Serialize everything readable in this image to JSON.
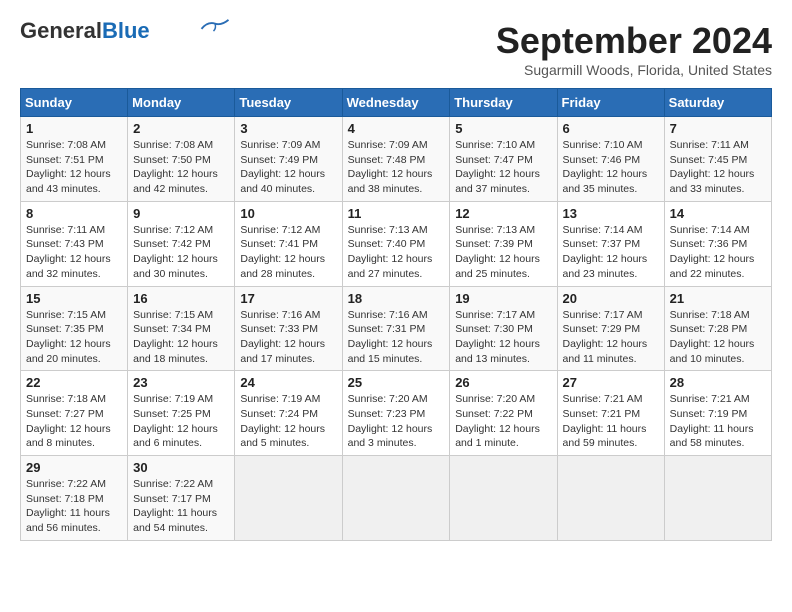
{
  "header": {
    "logo_line1": "General",
    "logo_line2": "Blue",
    "title": "September 2024",
    "subtitle": "Sugarmill Woods, Florida, United States"
  },
  "days_of_week": [
    "Sunday",
    "Monday",
    "Tuesday",
    "Wednesday",
    "Thursday",
    "Friday",
    "Saturday"
  ],
  "weeks": [
    [
      {
        "day": "1",
        "sunrise": "7:08 AM",
        "sunset": "7:51 PM",
        "daylight": "12 hours and 43 minutes."
      },
      {
        "day": "2",
        "sunrise": "7:08 AM",
        "sunset": "7:50 PM",
        "daylight": "12 hours and 42 minutes."
      },
      {
        "day": "3",
        "sunrise": "7:09 AM",
        "sunset": "7:49 PM",
        "daylight": "12 hours and 40 minutes."
      },
      {
        "day": "4",
        "sunrise": "7:09 AM",
        "sunset": "7:48 PM",
        "daylight": "12 hours and 38 minutes."
      },
      {
        "day": "5",
        "sunrise": "7:10 AM",
        "sunset": "7:47 PM",
        "daylight": "12 hours and 37 minutes."
      },
      {
        "day": "6",
        "sunrise": "7:10 AM",
        "sunset": "7:46 PM",
        "daylight": "12 hours and 35 minutes."
      },
      {
        "day": "7",
        "sunrise": "7:11 AM",
        "sunset": "7:45 PM",
        "daylight": "12 hours and 33 minutes."
      }
    ],
    [
      {
        "day": "8",
        "sunrise": "7:11 AM",
        "sunset": "7:43 PM",
        "daylight": "12 hours and 32 minutes."
      },
      {
        "day": "9",
        "sunrise": "7:12 AM",
        "sunset": "7:42 PM",
        "daylight": "12 hours and 30 minutes."
      },
      {
        "day": "10",
        "sunrise": "7:12 AM",
        "sunset": "7:41 PM",
        "daylight": "12 hours and 28 minutes."
      },
      {
        "day": "11",
        "sunrise": "7:13 AM",
        "sunset": "7:40 PM",
        "daylight": "12 hours and 27 minutes."
      },
      {
        "day": "12",
        "sunrise": "7:13 AM",
        "sunset": "7:39 PM",
        "daylight": "12 hours and 25 minutes."
      },
      {
        "day": "13",
        "sunrise": "7:14 AM",
        "sunset": "7:37 PM",
        "daylight": "12 hours and 23 minutes."
      },
      {
        "day": "14",
        "sunrise": "7:14 AM",
        "sunset": "7:36 PM",
        "daylight": "12 hours and 22 minutes."
      }
    ],
    [
      {
        "day": "15",
        "sunrise": "7:15 AM",
        "sunset": "7:35 PM",
        "daylight": "12 hours and 20 minutes."
      },
      {
        "day": "16",
        "sunrise": "7:15 AM",
        "sunset": "7:34 PM",
        "daylight": "12 hours and 18 minutes."
      },
      {
        "day": "17",
        "sunrise": "7:16 AM",
        "sunset": "7:33 PM",
        "daylight": "12 hours and 17 minutes."
      },
      {
        "day": "18",
        "sunrise": "7:16 AM",
        "sunset": "7:31 PM",
        "daylight": "12 hours and 15 minutes."
      },
      {
        "day": "19",
        "sunrise": "7:17 AM",
        "sunset": "7:30 PM",
        "daylight": "12 hours and 13 minutes."
      },
      {
        "day": "20",
        "sunrise": "7:17 AM",
        "sunset": "7:29 PM",
        "daylight": "12 hours and 11 minutes."
      },
      {
        "day": "21",
        "sunrise": "7:18 AM",
        "sunset": "7:28 PM",
        "daylight": "12 hours and 10 minutes."
      }
    ],
    [
      {
        "day": "22",
        "sunrise": "7:18 AM",
        "sunset": "7:27 PM",
        "daylight": "12 hours and 8 minutes."
      },
      {
        "day": "23",
        "sunrise": "7:19 AM",
        "sunset": "7:25 PM",
        "daylight": "12 hours and 6 minutes."
      },
      {
        "day": "24",
        "sunrise": "7:19 AM",
        "sunset": "7:24 PM",
        "daylight": "12 hours and 5 minutes."
      },
      {
        "day": "25",
        "sunrise": "7:20 AM",
        "sunset": "7:23 PM",
        "daylight": "12 hours and 3 minutes."
      },
      {
        "day": "26",
        "sunrise": "7:20 AM",
        "sunset": "7:22 PM",
        "daylight": "12 hours and 1 minute."
      },
      {
        "day": "27",
        "sunrise": "7:21 AM",
        "sunset": "7:21 PM",
        "daylight": "11 hours and 59 minutes."
      },
      {
        "day": "28",
        "sunrise": "7:21 AM",
        "sunset": "7:19 PM",
        "daylight": "11 hours and 58 minutes."
      }
    ],
    [
      {
        "day": "29",
        "sunrise": "7:22 AM",
        "sunset": "7:18 PM",
        "daylight": "11 hours and 56 minutes."
      },
      {
        "day": "30",
        "sunrise": "7:22 AM",
        "sunset": "7:17 PM",
        "daylight": "11 hours and 54 minutes."
      },
      null,
      null,
      null,
      null,
      null
    ]
  ],
  "labels": {
    "sunrise": "Sunrise:",
    "sunset": "Sunset:",
    "daylight": "Daylight:"
  }
}
